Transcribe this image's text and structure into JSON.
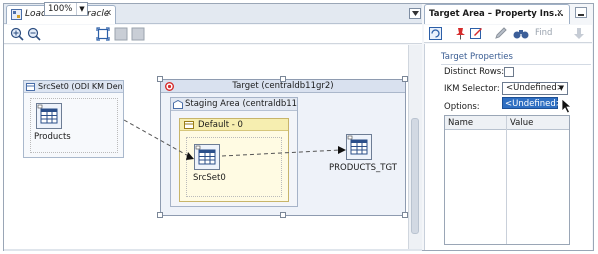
{
  "editor": {
    "tab_title": "Load File to Oracle",
    "tab_close": "x",
    "zoom_value": "100%"
  },
  "diagram": {
    "source_dataset_title": "SrcSet0 (ODI KM Den",
    "source_table_label": "Products",
    "target_area_title": "Target (centraldb11gr2)",
    "staging_area_title": "Staging Area (centraldb11",
    "default_dataset_title": "Default - 0",
    "staged_table_label": "SrcSet0",
    "target_table_label": "PRODUCTS_TGT"
  },
  "property_panel": {
    "title": "Target Area – Property Ins...",
    "close": "x",
    "find_placeholder": "Find",
    "section_title": "Target Properties",
    "distinct_rows_label": "Distinct Rows:",
    "ikm_selector_label": "IKM Selector:",
    "ikm_selected_value": "<Undefined>",
    "ikm_dropdown_option": "<Undefined>",
    "options_label": "Options:",
    "options_columns": [
      "Name",
      "Value"
    ]
  },
  "colors": {
    "accent": "#2f6fc2",
    "target_area_icon": "#d62b2b"
  }
}
